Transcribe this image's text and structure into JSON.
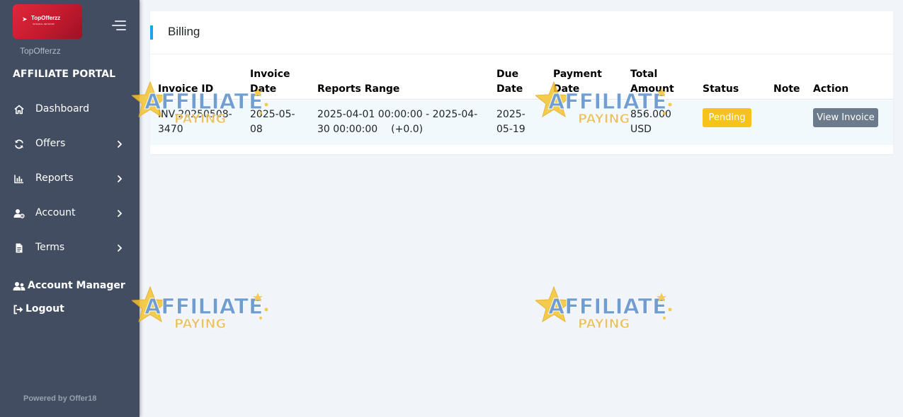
{
  "sidebar": {
    "logo_text": "TopOfferzz",
    "logo_sub": "INTEGRAL NETWORK",
    "brand_name": "TopOfferzz",
    "portal_title": "AFFILIATE PORTAL",
    "items": [
      {
        "label": "Dashboard",
        "icon": "home-icon",
        "has_submenu": false
      },
      {
        "label": "Offers",
        "icon": "sync-icon",
        "has_submenu": true
      },
      {
        "label": "Reports",
        "icon": "bar-chart-icon",
        "has_submenu": true
      },
      {
        "label": "Account",
        "icon": "user-cog-icon",
        "has_submenu": true
      },
      {
        "label": "Terms",
        "icon": "document-icon",
        "has_submenu": true
      }
    ],
    "account_manager_label": "Account Manager",
    "logout_label": "Logout",
    "powered_by": "Powered by Offer18"
  },
  "billing": {
    "title": "Billing",
    "columns": [
      {
        "line1": "Invoice ID",
        "line2": ""
      },
      {
        "line1": "Invoice",
        "line2": "Date"
      },
      {
        "line1": "Reports Range",
        "line2": ""
      },
      {
        "line1": "Due",
        "line2": "Date"
      },
      {
        "line1": "Payment",
        "line2": "Date"
      },
      {
        "line1": "Total",
        "line2": "Amount"
      },
      {
        "line1": "Status",
        "line2": ""
      },
      {
        "line1": "Note",
        "line2": ""
      },
      {
        "line1": "Action",
        "line2": ""
      }
    ],
    "rows": [
      {
        "invoice_id_1": "INV-20250508-",
        "invoice_id_2": "3470",
        "invoice_date_1": "2025-05-",
        "invoice_date_2": "08",
        "range_1": "2025-04-01 00:00:00 - 2025-04-",
        "range_2": "30 00:00:00",
        "range_tz": "(+0.0)",
        "due_date_1": "2025-",
        "due_date_2": "05-19",
        "payment_date": "",
        "amount_1": "856.000",
        "amount_2": "USD",
        "status": "Pending",
        "note": "",
        "action_label": "View Invoice"
      }
    ]
  },
  "watermark": {
    "line1": "AFFILIATE",
    "line2": "PAYING"
  },
  "colors": {
    "sidebar_bg": "#424d61",
    "accent": "#1aa3e8",
    "pending": "#f6c21c",
    "button": "#6c7b8b"
  }
}
